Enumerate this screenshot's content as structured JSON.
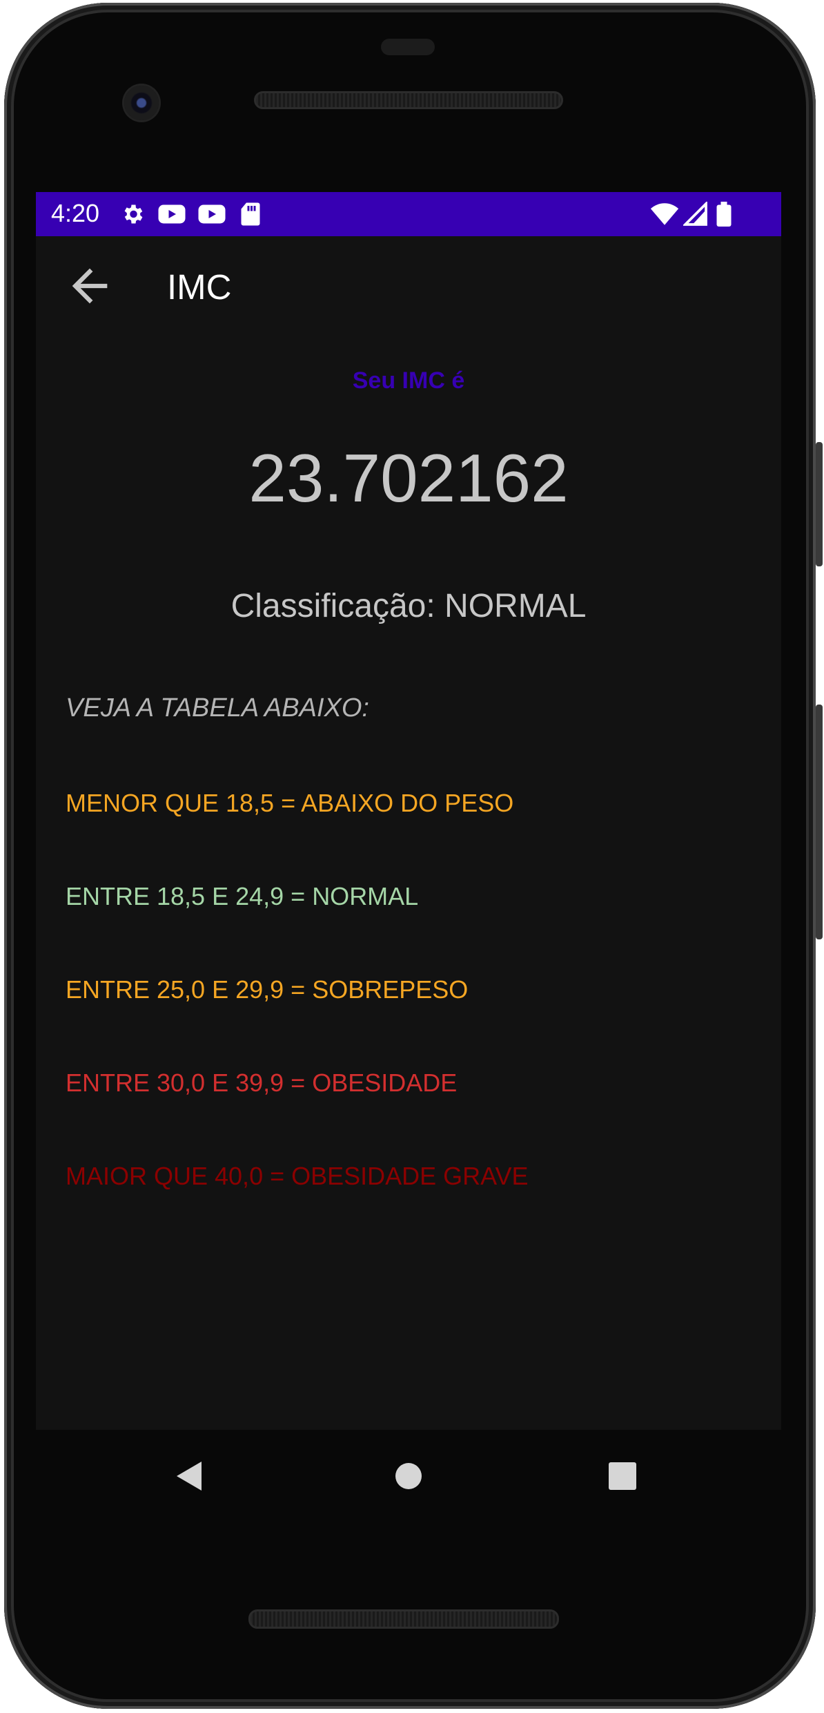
{
  "status_bar": {
    "time": "4:20",
    "icons_left": [
      "gear-icon",
      "youtube-icon",
      "youtube-icon",
      "sd-card-icon"
    ],
    "icons_right": [
      "wifi-icon",
      "cell-signal-icon",
      "battery-icon"
    ],
    "color": "#3700b3"
  },
  "app_bar": {
    "title": "IMC",
    "back_icon": "arrow-back-icon"
  },
  "result": {
    "label": "Seu IMC é",
    "value": "23.702162",
    "classification": "Classificação: NORMAL"
  },
  "table": {
    "title": "VEJA A TABELA ABAIXO:",
    "rows": [
      {
        "text": "MENOR QUE 18,5 = ABAIXO DO PESO",
        "color": "#f5a623"
      },
      {
        "text": "ENTRE 18,5 E 24,9 = NORMAL",
        "color": "#a5d6a7"
      },
      {
        "text": "ENTRE 25,0 E 29,9 = SOBREPESO",
        "color": "#f5a623"
      },
      {
        "text": "ENTRE 30,0 E 39,9 = OBESIDADE",
        "color": "#d32f2f"
      },
      {
        "text": "MAIOR QUE 40,0 = OBESIDADE GRAVE",
        "color": "#8b0000"
      }
    ]
  },
  "nav_bar": {
    "buttons": [
      "back-triangle-icon",
      "home-circle-icon",
      "recents-square-icon"
    ]
  }
}
